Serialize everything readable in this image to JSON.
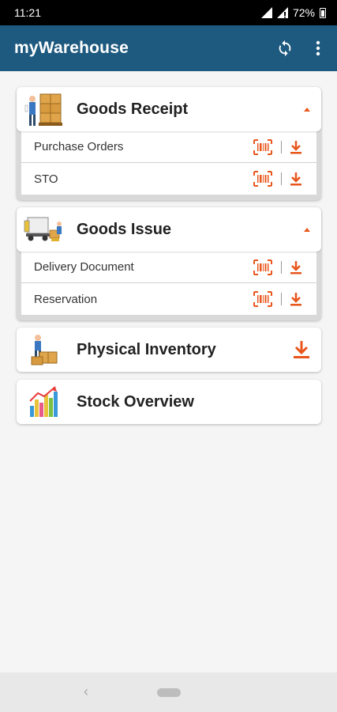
{
  "status_bar": {
    "time": "11:21",
    "battery": "72%"
  },
  "app_bar": {
    "title": "myWarehouse",
    "refresh_icon": "refresh-icon",
    "menu_icon": "more-vert-icon"
  },
  "colors": {
    "app_bar": "#1e5a7f",
    "accent": "#e8561c",
    "background": "#f5f5f5"
  },
  "sections": {
    "goods_receipt": {
      "title": "Goods Receipt",
      "expanded": true,
      "items": [
        {
          "label": "Purchase Orders"
        },
        {
          "label": "STO"
        }
      ]
    },
    "goods_issue": {
      "title": "Goods Issue",
      "expanded": true,
      "items": [
        {
          "label": "Delivery Document"
        },
        {
          "label": "Reservation"
        }
      ]
    },
    "physical_inventory": {
      "title": "Physical Inventory"
    },
    "stock_overview": {
      "title": "Stock Overview"
    }
  },
  "nav_bar": {
    "back_icon": "back-icon",
    "home_icon": "home-pill-icon"
  }
}
